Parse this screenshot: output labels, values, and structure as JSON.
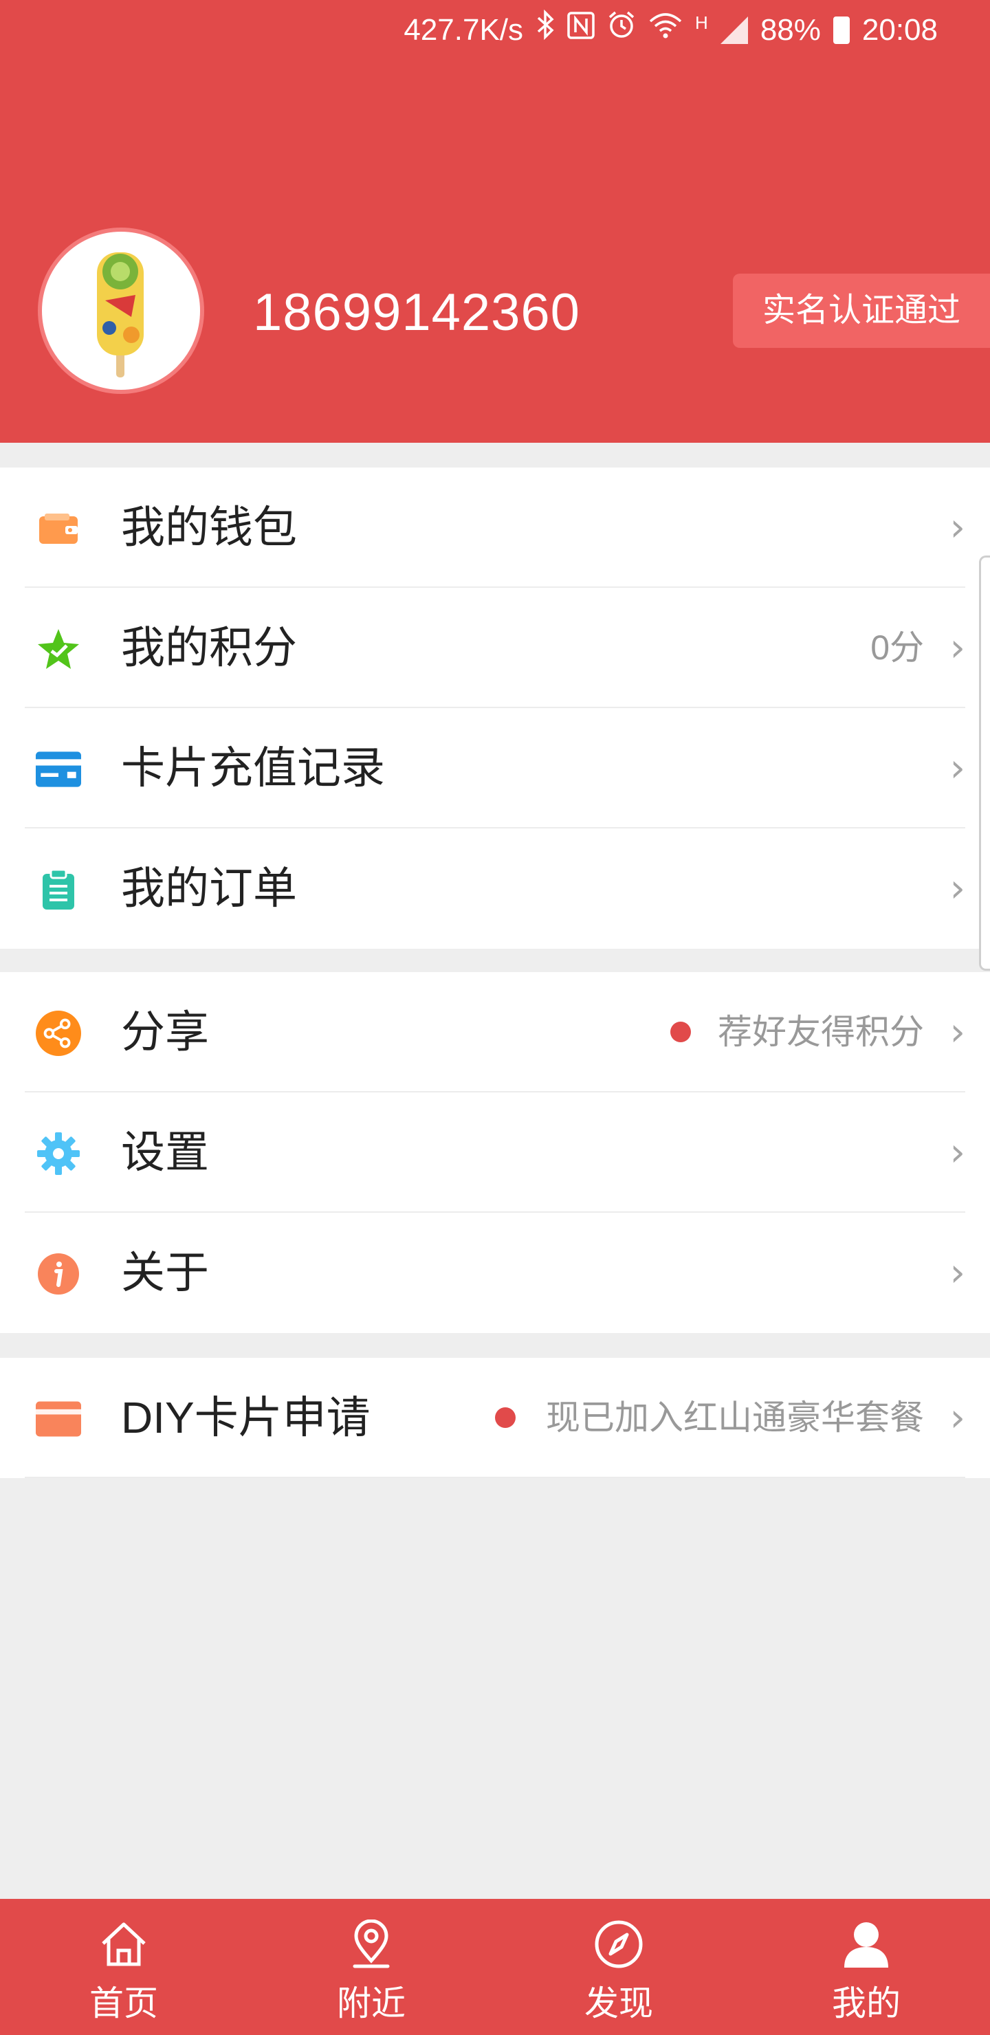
{
  "status_bar": {
    "net_speed": "427.7K/s",
    "network_type": "H",
    "battery": "88%",
    "time": "20:08",
    "icons": [
      "bluetooth-icon",
      "nfc-icon",
      "alarm-icon",
      "wifi-icon",
      "signal-icon",
      "battery-icon"
    ]
  },
  "profile": {
    "phone": "18699142360",
    "verify_badge": "实名认证通过"
  },
  "menu_group_1": [
    {
      "label": "我的钱包",
      "value": "",
      "icon": "wallet-icon",
      "icon_color": "#ff9a4d"
    },
    {
      "label": "我的积分",
      "value": "0分",
      "icon": "points-star-icon",
      "icon_color": "#52c41a"
    },
    {
      "label": "卡片充值记录",
      "value": "",
      "icon": "card-icon",
      "icon_color": "#1e90e0"
    },
    {
      "label": "我的订单",
      "value": "",
      "icon": "order-clipboard-icon",
      "icon_color": "#2ec4a9"
    }
  ],
  "menu_group_2": [
    {
      "label": "分享",
      "value": "荐好友得积分",
      "icon": "share-icon",
      "icon_color": "#ff8c1a",
      "dot": true
    },
    {
      "label": "设置",
      "value": "",
      "icon": "settings-gear-icon",
      "icon_color": "#4fc3f7"
    },
    {
      "label": "关于",
      "value": "",
      "icon": "info-icon",
      "icon_color": "#f9845b"
    }
  ],
  "menu_group_3": [
    {
      "label": "DIY卡片申请",
      "value": "现已加入红山通豪华套餐",
      "icon": "diy-card-icon",
      "icon_color": "#f9845b",
      "dot": true
    }
  ],
  "tabbar": [
    {
      "label": "首页",
      "icon": "home-icon"
    },
    {
      "label": "附近",
      "icon": "location-pin-icon"
    },
    {
      "label": "发现",
      "icon": "compass-icon"
    },
    {
      "label": "我的",
      "icon": "user-icon",
      "active": true
    }
  ],
  "colors": {
    "brand_red": "#e14a4a",
    "badge_red": "#f16464",
    "background": "#eeeeee"
  }
}
